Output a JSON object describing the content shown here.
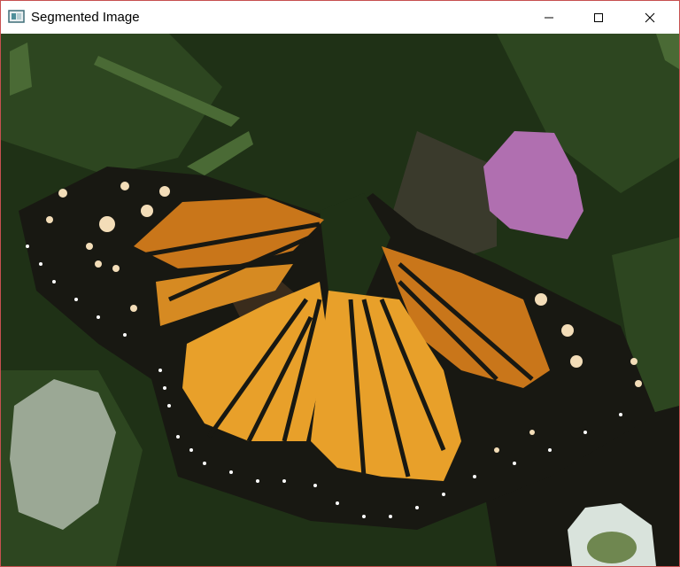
{
  "window": {
    "title": "Segmented Image",
    "app_icon": "image-window-icon",
    "controls": {
      "minimize_icon": "minimize-icon",
      "maximize_icon": "maximize-icon",
      "close_icon": "close-icon"
    },
    "border_color": "#c75050"
  },
  "image": {
    "description_name": "segmented-monarch-butterfly-image",
    "palette": {
      "background_dark_green": "#1f3116",
      "mid_green": "#2d4620",
      "light_green": "#4a6a35",
      "very_dark": "#181812",
      "brown_dark": "#3a2c1c",
      "orange_dark": "#c9761a",
      "orange_light": "#e8a02a",
      "orange_mid": "#d68a22",
      "cream": "#f3ddb8",
      "pink_flower": "#b06fb0",
      "gray_flower": "#9ba895",
      "white_flower": "#d9e3dc"
    }
  }
}
